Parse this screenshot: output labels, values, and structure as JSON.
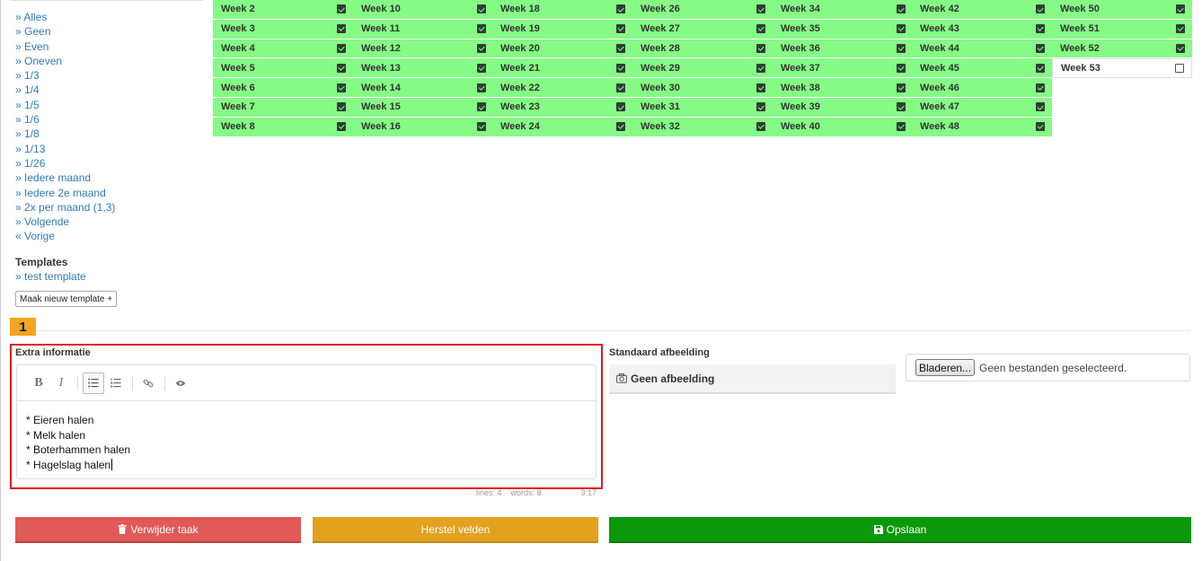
{
  "quick_select": [
    "» Alles",
    "» Geen",
    "» Even",
    "» Oneven",
    "» 1/3",
    "» 1/4",
    "» 1/5",
    "» 1/6",
    "» 1/8",
    "» 1/13",
    "» 1/26",
    "» Iedere maand",
    "» Iedere 2e maand",
    "» 2x per maand (1,3)",
    "» Volgende",
    "« Vorige"
  ],
  "templates": {
    "title": "Templates",
    "items": [
      "» test template"
    ],
    "new_button": "Maak nieuw template +"
  },
  "weeks": {
    "columns": [
      [
        {
          "label": "Week 2",
          "checked": true
        },
        {
          "label": "Week 3",
          "checked": true
        },
        {
          "label": "Week 4",
          "checked": true
        },
        {
          "label": "Week 5",
          "checked": true
        },
        {
          "label": "Week 6",
          "checked": true
        },
        {
          "label": "Week 7",
          "checked": true
        },
        {
          "label": "Week 8",
          "checked": true
        }
      ],
      [
        {
          "label": "Week 10",
          "checked": true
        },
        {
          "label": "Week 11",
          "checked": true
        },
        {
          "label": "Week 12",
          "checked": true
        },
        {
          "label": "Week 13",
          "checked": true
        },
        {
          "label": "Week 14",
          "checked": true
        },
        {
          "label": "Week 15",
          "checked": true
        },
        {
          "label": "Week 16",
          "checked": true
        }
      ],
      [
        {
          "label": "Week 18",
          "checked": true
        },
        {
          "label": "Week 19",
          "checked": true
        },
        {
          "label": "Week 20",
          "checked": true
        },
        {
          "label": "Week 21",
          "checked": true
        },
        {
          "label": "Week 22",
          "checked": true
        },
        {
          "label": "Week 23",
          "checked": true
        },
        {
          "label": "Week 24",
          "checked": true
        }
      ],
      [
        {
          "label": "Week 26",
          "checked": true
        },
        {
          "label": "Week 27",
          "checked": true
        },
        {
          "label": "Week 28",
          "checked": true
        },
        {
          "label": "Week 29",
          "checked": true
        },
        {
          "label": "Week 30",
          "checked": true
        },
        {
          "label": "Week 31",
          "checked": true
        },
        {
          "label": "Week 32",
          "checked": true
        }
      ],
      [
        {
          "label": "Week 34",
          "checked": true
        },
        {
          "label": "Week 35",
          "checked": true
        },
        {
          "label": "Week 36",
          "checked": true
        },
        {
          "label": "Week 37",
          "checked": true
        },
        {
          "label": "Week 38",
          "checked": true
        },
        {
          "label": "Week 39",
          "checked": true
        },
        {
          "label": "Week 40",
          "checked": true
        }
      ],
      [
        {
          "label": "Week 42",
          "checked": true
        },
        {
          "label": "Week 43",
          "checked": true
        },
        {
          "label": "Week 44",
          "checked": true
        },
        {
          "label": "Week 45",
          "checked": true
        },
        {
          "label": "Week 46",
          "checked": true
        },
        {
          "label": "Week 47",
          "checked": true
        },
        {
          "label": "Week 48",
          "checked": true
        }
      ],
      [
        {
          "label": "Week 50",
          "checked": true
        },
        {
          "label": "Week 51",
          "checked": true
        },
        {
          "label": "Week 52",
          "checked": true
        },
        {
          "label": "Week 53",
          "checked": false
        }
      ]
    ]
  },
  "annotation": {
    "label": "1"
  },
  "extra_info": {
    "title": "Extra informatie",
    "toolbar": {
      "bold": "B",
      "italic": "I"
    },
    "lines": [
      "* Eieren halen",
      "* Melk halen",
      "* Boterhammen halen",
      "* Hagelslag halen"
    ],
    "status": {
      "lines": "lines: 4",
      "words": "words: 8",
      "cursor": "3:17"
    }
  },
  "standard_image": {
    "title": "Standaard afbeelding",
    "placeholder": "Geen afbeelding",
    "browse_label": "Bladeren...",
    "no_file": "Geen bestanden geselecteerd."
  },
  "actions": {
    "delete": "Verwijder taak",
    "reset": "Herstel velden",
    "save": "Opslaan"
  },
  "colors": {
    "week_checked": "#85fb85",
    "delete": "#e05a57",
    "reset": "#e2a11f",
    "save": "#0b980b",
    "highlight": "#e11b1b",
    "badge": "#f4a51f"
  }
}
